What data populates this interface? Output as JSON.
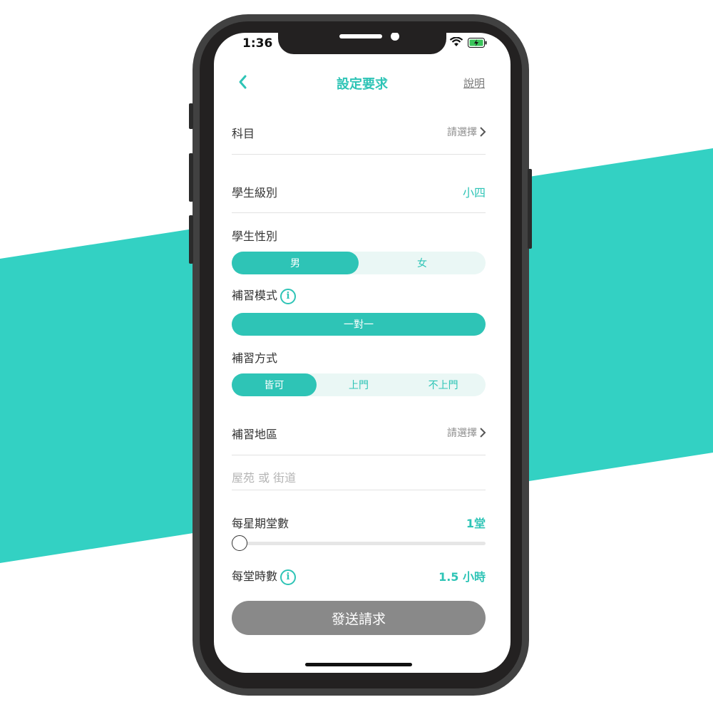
{
  "status_bar": {
    "time": "1:36"
  },
  "nav": {
    "title": "設定要求",
    "help": "說明"
  },
  "subject": {
    "label": "科目",
    "value": "請選擇"
  },
  "grade": {
    "label": "學生級別",
    "value": "小四"
  },
  "gender": {
    "label": "學生性別",
    "options": [
      "男",
      "女"
    ],
    "selected": "男"
  },
  "tutoring_mode": {
    "label": "補習模式",
    "options": [
      "一對一"
    ],
    "selected": "一對一"
  },
  "tutoring_method": {
    "label": "補習方式",
    "options": [
      "皆可",
      "上門",
      "不上門"
    ],
    "selected": "皆可"
  },
  "district": {
    "label": "補習地區",
    "value": "請選擇"
  },
  "address": {
    "placeholder": "屋苑 或 街道",
    "value": ""
  },
  "lessons_per_week": {
    "label": "每星期堂數",
    "value": "1堂",
    "slider_fraction": 0
  },
  "hours_per_lesson": {
    "label": "每堂時數",
    "value": "1.5 小時"
  },
  "submit": {
    "label": "發送請求"
  },
  "colors": {
    "accent": "#2ec4b6",
    "disabled_button": "#898989",
    "background_stripe": "#33d1c3"
  },
  "icons": [
    "back-chevron-icon",
    "chevron-right-icon",
    "info-icon",
    "wifi-icon",
    "battery-charging-icon"
  ]
}
